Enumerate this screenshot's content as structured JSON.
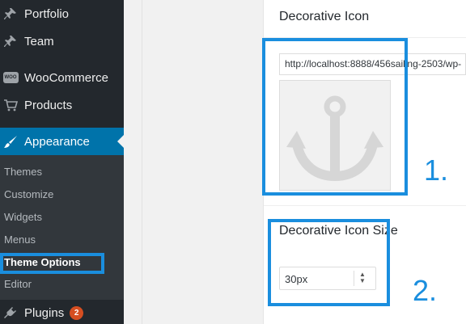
{
  "sidebar": {
    "items": [
      {
        "label": "Portfolio",
        "icon": "pin-icon"
      },
      {
        "label": "Team",
        "icon": "pin-icon"
      },
      {
        "label": "WooCommerce",
        "icon": "woocommerce-icon"
      },
      {
        "label": "Products",
        "icon": "cart-icon"
      },
      {
        "label": "Appearance",
        "icon": "paintbrush-icon"
      },
      {
        "label": "Plugins",
        "icon": "plug-icon",
        "badge": "2"
      }
    ],
    "woo_icon_text": "WOO",
    "submenu": [
      "Themes",
      "Customize",
      "Widgets",
      "Menus",
      "Theme Options",
      "Editor"
    ]
  },
  "fields": {
    "icon": {
      "title": "Decorative Icon",
      "url_value": "http://localhost:8888/456sailing-2503/wp-"
    },
    "size": {
      "title": "Decorative Icon Size",
      "selected": "30px"
    }
  },
  "annotations": {
    "one": "1.",
    "two": "2."
  },
  "colors": {
    "sidebar_bg": "#23282d",
    "submenu_bg": "#32373c",
    "active_bg": "#0073aa",
    "annotation": "#1a8ede"
  }
}
